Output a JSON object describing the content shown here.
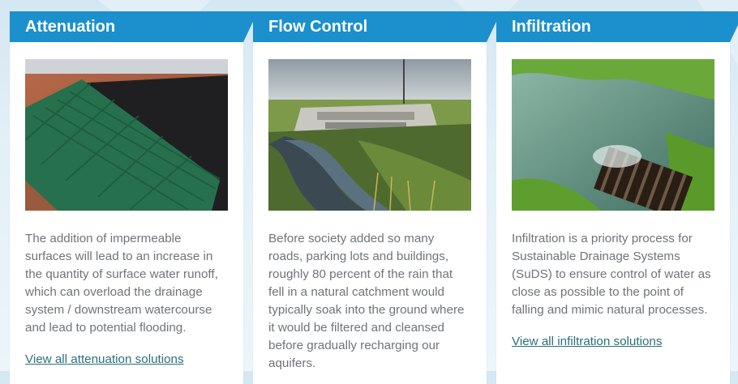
{
  "cards": [
    {
      "title": "Attenuation",
      "body": "The addition of impermeable\nsurfaces will lead to an increase in\nthe quantity of surface water runoff,\nwhich can overload the drainage\nsystem / downstream watercourse\nand lead to potential flooding.",
      "link": "View all attenuation solutions"
    },
    {
      "title": "Flow Control",
      "body": "Before society added so many\nroads, parking lots and buildings,\nroughly 80 percent of the rain that\nfell in a natural catchment would\ntypically soak into the ground where\nit would be filtered and cleansed\nbefore gradually recharging our\naquifers.",
      "link": ""
    },
    {
      "title": "Infiltration",
      "body": "Infiltration is a priority process for\nSustainable Drainage Systems\n(SuDS) to ensure control of water as\nclose as possible to the point of\nfalling and mimic natural processes.",
      "link": "View all infiltration solutions"
    }
  ],
  "colors": {
    "header_blue": "#1b90cc",
    "body_text": "#707478",
    "link_text": "#2a6f7a"
  }
}
